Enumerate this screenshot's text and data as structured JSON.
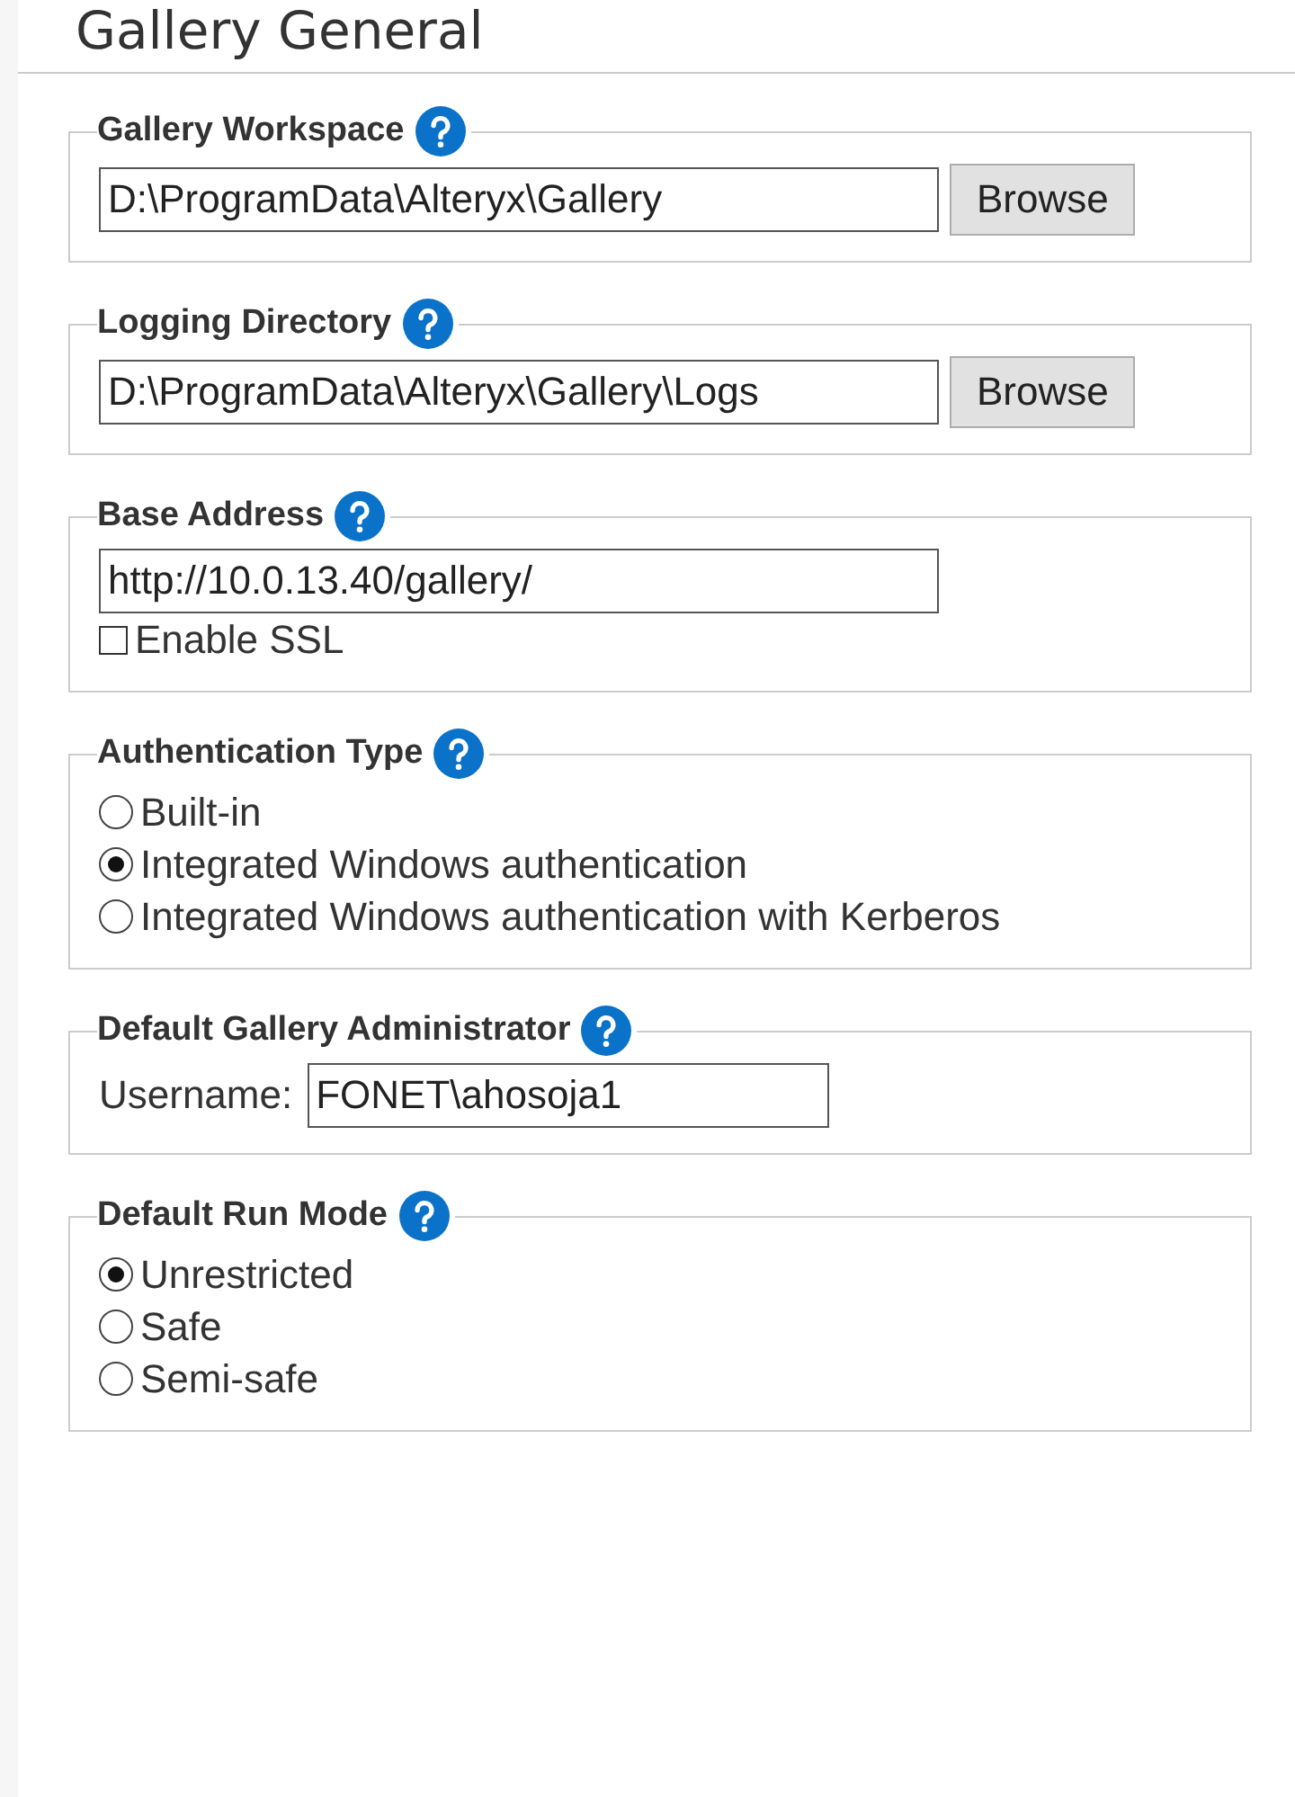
{
  "heading": "Gallery General",
  "sections": [
    {
      "kind": "path",
      "title": "Gallery Workspace",
      "value": "D:\\ProgramData\\Alteryx\\Gallery",
      "button": "Browse"
    },
    {
      "kind": "path",
      "title": "Logging Directory",
      "value": "D:\\ProgramData\\Alteryx\\Gallery\\Logs",
      "button": "Browse"
    },
    {
      "kind": "url",
      "title": "Base Address",
      "value": "http://10.0.13.40/gallery/",
      "checkbox": {
        "label": "Enable SSL",
        "checked": false
      }
    },
    {
      "kind": "radio",
      "title": "Authentication Type",
      "options": [
        {
          "label": "Built-in",
          "selected": false
        },
        {
          "label": "Integrated Windows authentication",
          "selected": true
        },
        {
          "label": "Integrated Windows authentication with Kerberos",
          "selected": false
        }
      ]
    },
    {
      "kind": "user",
      "title": "Default Gallery Administrator",
      "label": "Username:",
      "value": "FONET\\ahosoja1"
    },
    {
      "kind": "radio",
      "title": "Default Run Mode",
      "options": [
        {
          "label": "Unrestricted",
          "selected": true
        },
        {
          "label": "Safe",
          "selected": false
        },
        {
          "label": "Semi-safe",
          "selected": false
        }
      ]
    }
  ]
}
